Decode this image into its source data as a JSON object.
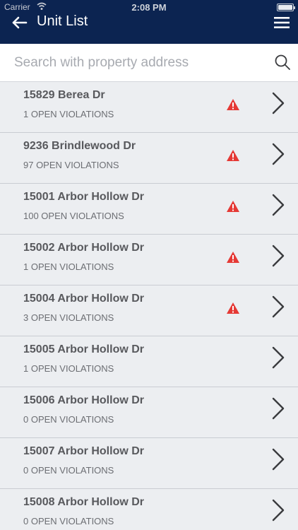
{
  "status_bar": {
    "carrier": "Carrier",
    "time": "2:08 PM",
    "battery_level": 1.0
  },
  "header": {
    "title": "Unit List",
    "back_icon": "arrow-left-icon",
    "menu_icon": "hamburger-menu-icon"
  },
  "search": {
    "placeholder": "Search with property address",
    "value": "",
    "icon": "search-icon"
  },
  "colors": {
    "header_bg": "#0c2451",
    "warning": "#e53935",
    "row_bg": "#eceef1"
  },
  "units": [
    {
      "address": "15829 Berea Dr",
      "violations": "1 OPEN VIOLATIONS",
      "warning": true
    },
    {
      "address": "9236 Brindlewood Dr",
      "violations": "97 OPEN VIOLATIONS",
      "warning": true
    },
    {
      "address": "15001 Arbor Hollow Dr",
      "violations": "100 OPEN VIOLATIONS",
      "warning": true
    },
    {
      "address": "15002 Arbor Hollow Dr",
      "violations": "1 OPEN VIOLATIONS",
      "warning": true
    },
    {
      "address": "15004 Arbor Hollow Dr",
      "violations": "3 OPEN VIOLATIONS",
      "warning": true
    },
    {
      "address": "15005 Arbor Hollow Dr",
      "violations": "1 OPEN VIOLATIONS",
      "warning": false
    },
    {
      "address": "15006 Arbor Hollow Dr",
      "violations": "0 OPEN VIOLATIONS",
      "warning": false
    },
    {
      "address": "15007 Arbor Hollow Dr",
      "violations": "0 OPEN VIOLATIONS",
      "warning": false
    },
    {
      "address": "15008 Arbor Hollow Dr",
      "violations": "0 OPEN VIOLATIONS",
      "warning": false
    }
  ]
}
